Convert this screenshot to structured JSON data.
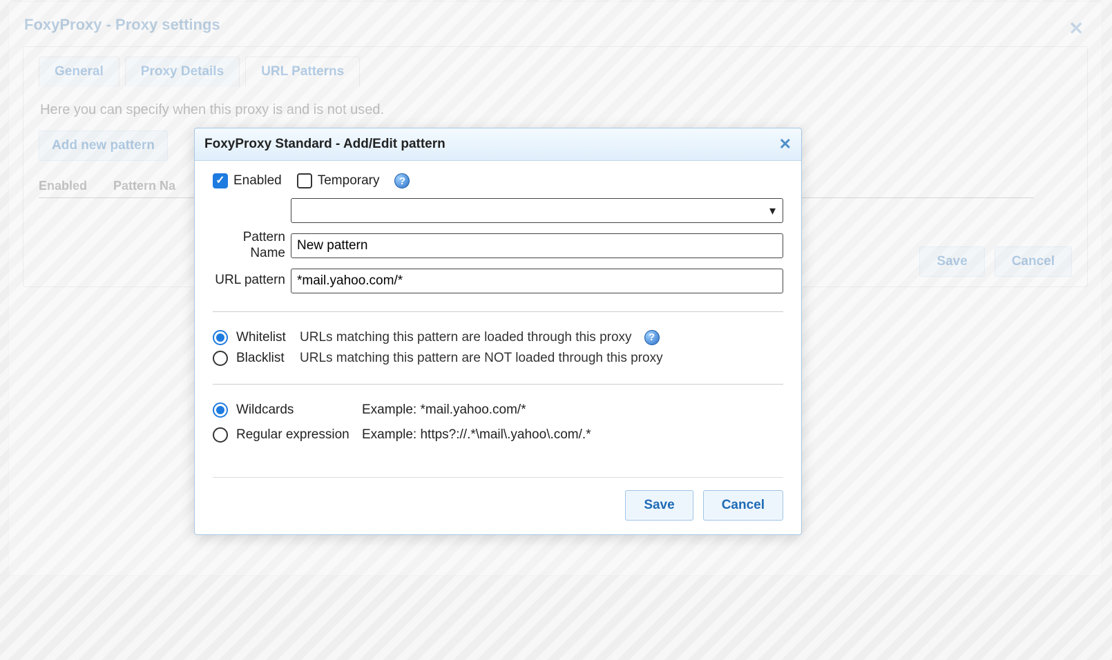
{
  "background": {
    "title": "FoxyProxy - Proxy settings",
    "tabs": [
      "General",
      "Proxy Details",
      "URL Patterns"
    ],
    "active_tab_index": 2,
    "description": "Here you can specify when this proxy is and is not used.",
    "add_pattern_button": "Add new pattern",
    "table_headers": [
      "Enabled",
      "Pattern Na"
    ],
    "save_button": "Save",
    "cancel_button": "Cancel"
  },
  "modal": {
    "title": "FoxyProxy Standard - Add/Edit pattern",
    "enabled_label": "Enabled",
    "enabled_checked": true,
    "temporary_label": "Temporary",
    "temporary_checked": false,
    "pattern_name_label": "Pattern Name",
    "pattern_name_value": "New pattern",
    "url_pattern_label": "URL pattern",
    "url_pattern_value": "*mail.yahoo.com/*",
    "list_mode": {
      "whitelist_label": "Whitelist",
      "whitelist_desc": "URLs matching this pattern are loaded through this proxy",
      "blacklist_label": "Blacklist",
      "blacklist_desc": "URLs matching this pattern are NOT loaded through this proxy",
      "selected": "whitelist"
    },
    "match_type": {
      "wildcards_label": "Wildcards",
      "wildcards_example": "Example: *mail.yahoo.com/*",
      "regex_label": "Regular expression",
      "regex_example": "Example: https?://.*\\mail\\.yahoo\\.com/.*",
      "selected": "wildcards"
    },
    "save_button": "Save",
    "cancel_button": "Cancel"
  }
}
